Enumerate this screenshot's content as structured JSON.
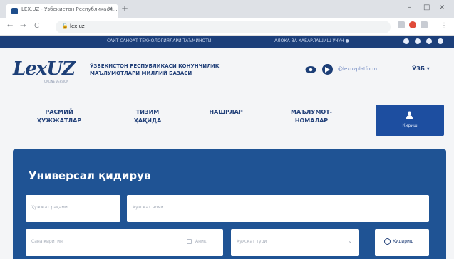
{
  "browser": {
    "tab_title": "LEX.UZ - Ўзбекистон Республикаси...",
    "url": "lex.uz",
    "close_glyph": "×",
    "new_tab_glyph": "+",
    "back_glyph": "←",
    "forward_glyph": "→",
    "reload_glyph": "C",
    "menu_glyph": "⋮",
    "lock_glyph": "🔒",
    "minimize_glyph": "–",
    "maximize_glyph": "□",
    "window_close_glyph": "×"
  },
  "site_topbar": {
    "left_text": "САЙТ САНОАТ ТЕХНОЛОГИЯЛАРИ ТАЪМИНОТИ",
    "right_text": "АЛОҚА ВА ХАБАРЛАШИШ УЧУН ●"
  },
  "header": {
    "logo_text": "LexUZ",
    "logo_subtext": "ONLINE VERSION",
    "site_title_line1": "ЎЗБЕКИСТОН РЕСПУБЛИКАСИ ҚОНУНЧИЛИК",
    "site_title_line2": "МАЪЛУМОТЛАРИ МИЛЛИЙ БАЗАСИ",
    "handle": "@lexuzplatform",
    "language": "ЎЗБ ▾"
  },
  "nav": {
    "items": [
      {
        "line1": "РАСМИЙ",
        "line2": "ҲУЖЖАТЛАР"
      },
      {
        "line1": "ТИЗИМ",
        "line2": "ҲАҚИДА"
      },
      {
        "line1": "НАШРЛАР",
        "line2": ""
      },
      {
        "line1": "МАЪЛУМОТ-",
        "line2": "НОМАЛАР"
      }
    ],
    "login_label": "Кириш"
  },
  "search": {
    "title": "Универсал қидирув",
    "doc_number_placeholder": "Ҳужжат рақами",
    "doc_name_placeholder": "Ҳужжат номи",
    "date_placeholder": "Сана киритинг",
    "exact_label": "Аниқ",
    "doc_type_placeholder": "Ҳужжат тури",
    "search_button": "Қидириш"
  },
  "colors": {
    "brand_dark": "#1d3f77",
    "panel_blue": "#1f5394",
    "login_blue": "#1d4ea0"
  }
}
